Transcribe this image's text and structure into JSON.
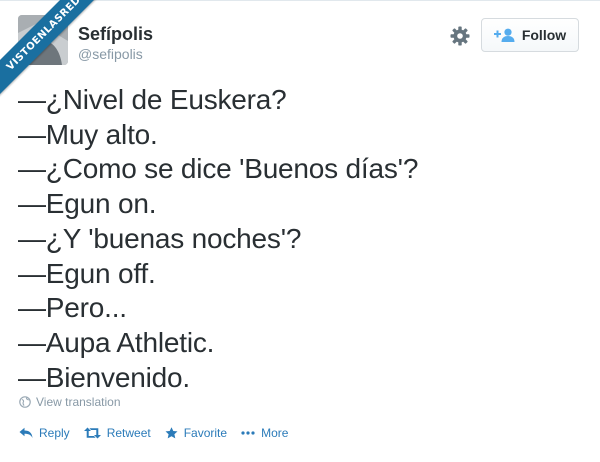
{
  "header": {
    "display_name": "Sefípolis",
    "handle": "@sefipolis",
    "follow_label": "Follow"
  },
  "tweet": {
    "lines": [
      "—¿Nivel de Euskera?",
      "—Muy alto.",
      "—¿Como se dice 'Buenos días'?",
      "—Egun on.",
      "—¿Y 'buenas noches'?",
      "—Egun off.",
      "—Pero...",
      "—Aupa Athletic.",
      "—Bienvenido."
    ],
    "translate_label": "View translation"
  },
  "actions": {
    "reply": "Reply",
    "retweet": "Retweet",
    "favorite": "Favorite",
    "more": "More"
  },
  "watermark": {
    "text": "VISTOENLASREDES"
  },
  "colors": {
    "text": "#292f33",
    "muted": "#8899a6",
    "link": "#2b7bb9",
    "watermark": "#1a6fa0"
  },
  "icons": [
    "gear-icon",
    "follow-person-plus-icon",
    "globe-icon",
    "reply-icon",
    "retweet-icon",
    "favorite-star-icon",
    "more-dots-icon"
  ]
}
